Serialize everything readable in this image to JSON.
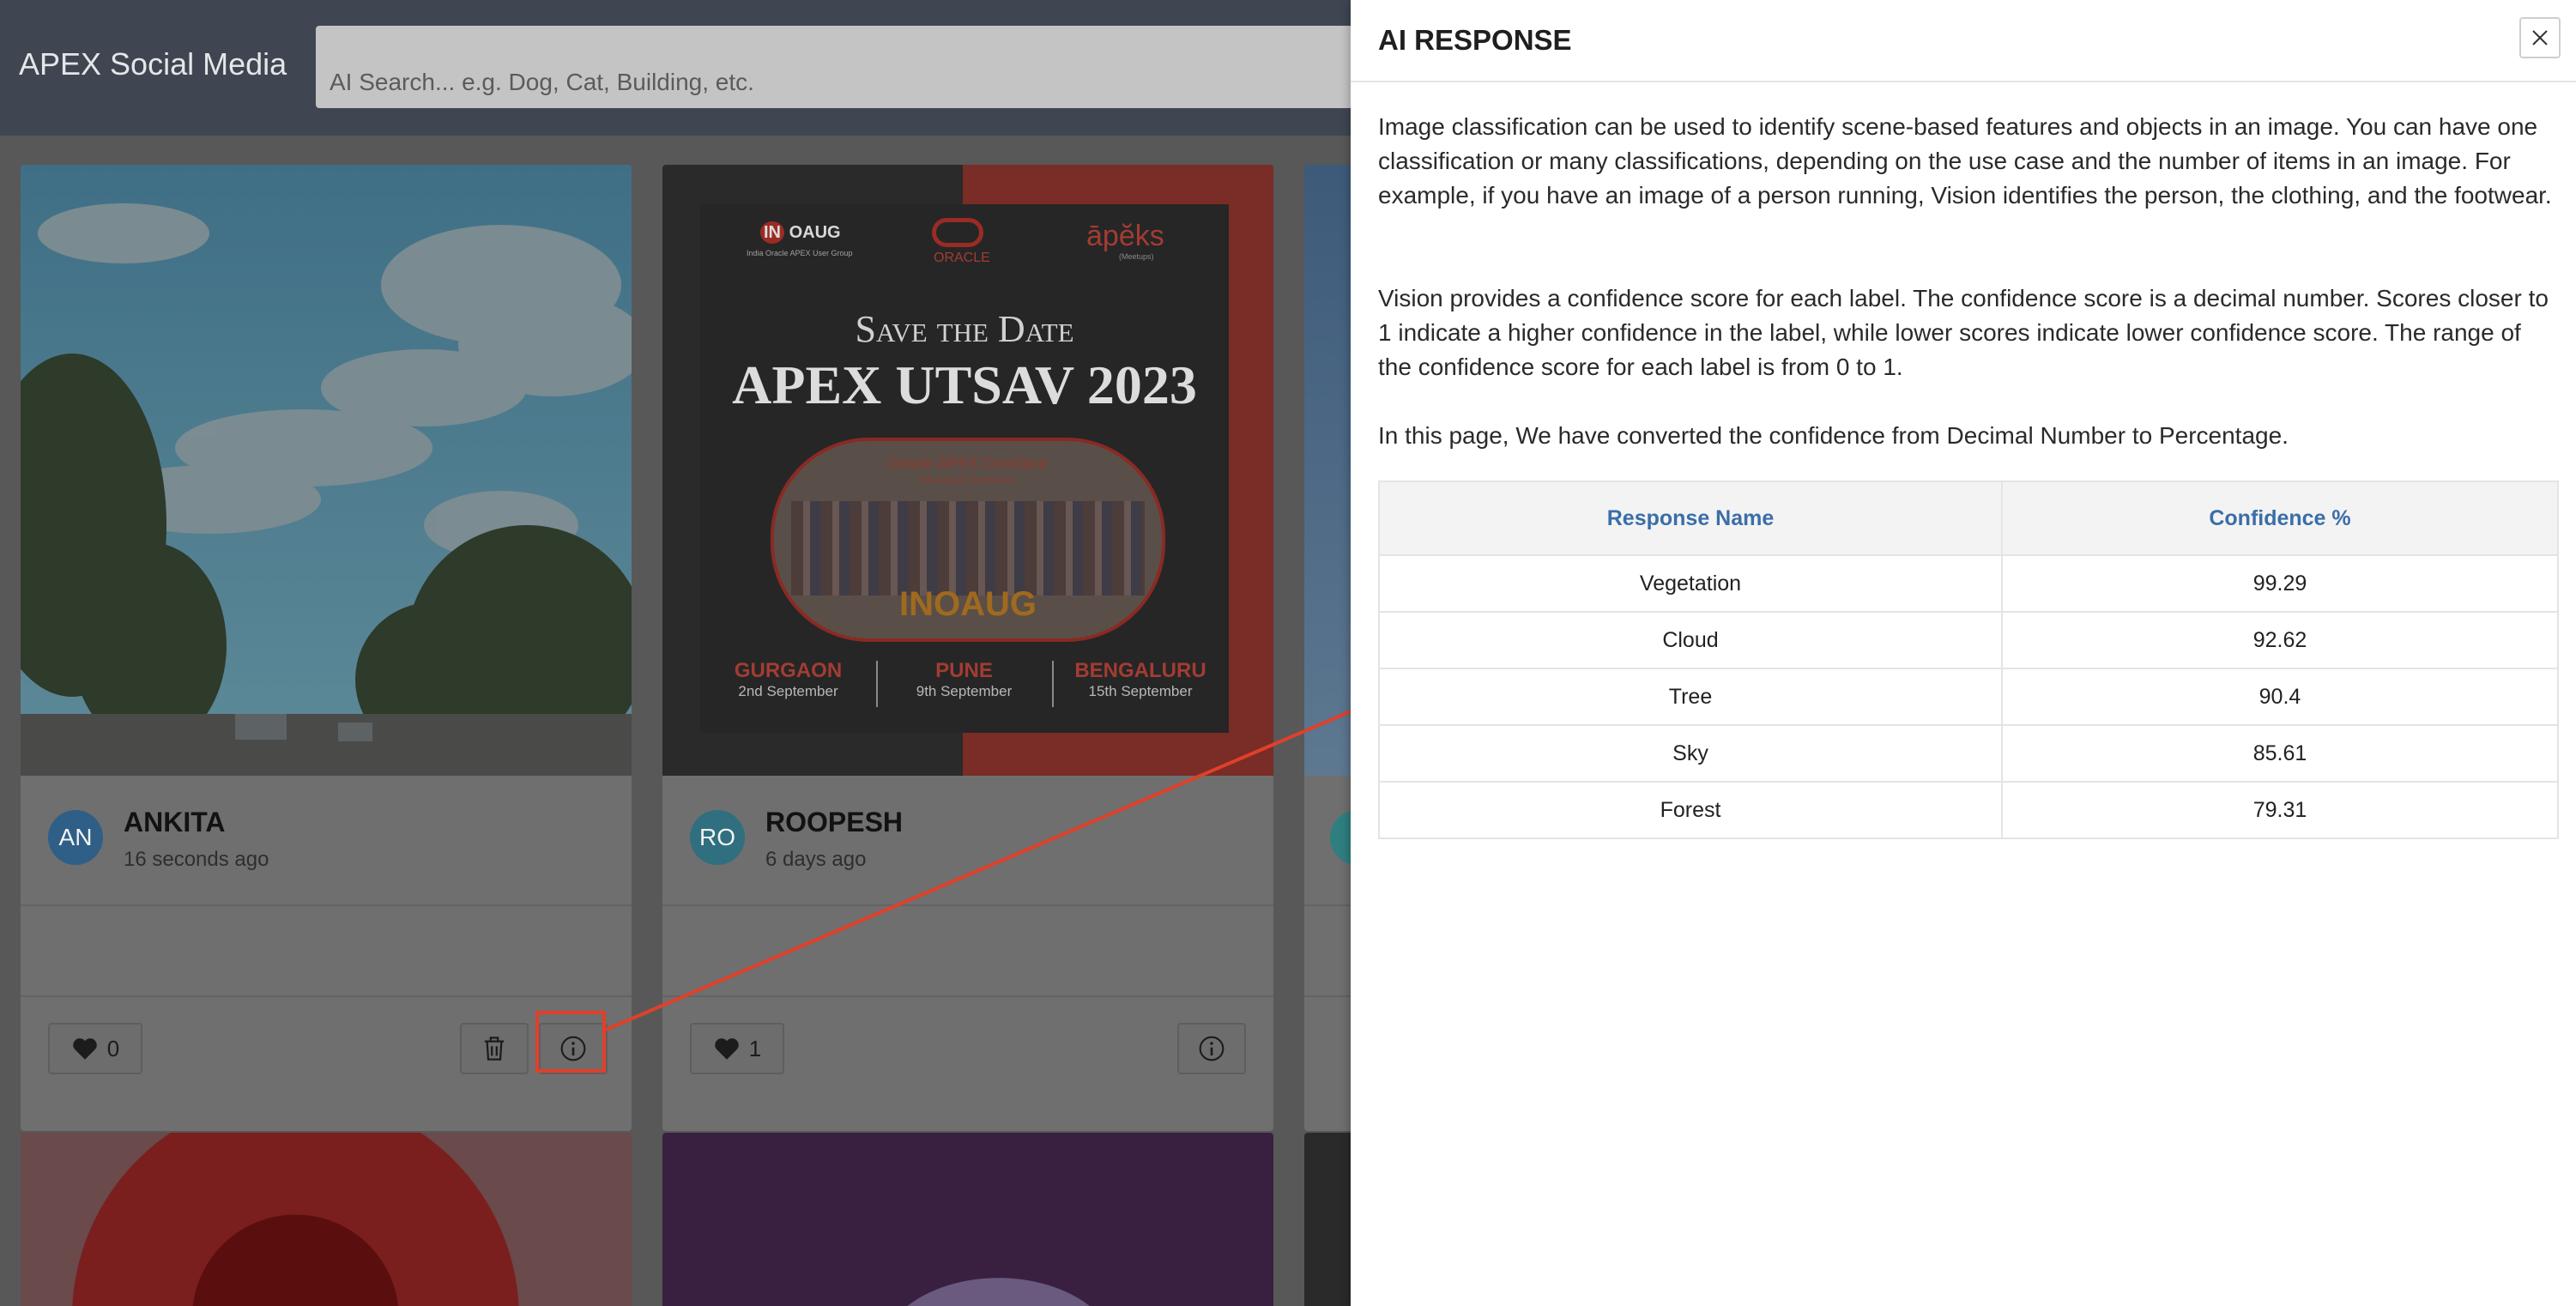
{
  "app": {
    "title": "APEX Social Media"
  },
  "search": {
    "placeholder": "AI Search... e.g. Dog, Cat, Building, etc."
  },
  "posts": [
    {
      "initials": "AN",
      "name": "ANKITA",
      "time": "16 seconds ago",
      "likes": "0",
      "avatar_color": "#3a7cb0"
    },
    {
      "initials": "RO",
      "name": "ROOPESH",
      "time": "6 days ago",
      "likes": "1",
      "avatar_color": "#3a8fa6"
    }
  ],
  "event_poster": {
    "org1": "OAUG",
    "org1_mark": "IN",
    "org1_sub": "India Oracle APEX User Group",
    "org2": "ORACLE",
    "org3": "āpĕks",
    "org3_sub": "(Meetups)",
    "headline1": "Save the Date",
    "headline2": "APEX UTSAV 2023",
    "photo_title": "Oracle APEX Conclave",
    "photo_subtitle": "5th Annual Conference",
    "photo_caption": "INOAUG",
    "city1": "GURGAON",
    "date1": "2nd September",
    "city2": "PUNE",
    "date2": "9th September",
    "city3": "BENGALURU",
    "date3": "15th September"
  },
  "panel": {
    "title": "AI RESPONSE",
    "para1": "Image classification can be used to identify scene-based features and objects in an image. You can have one classification or many classifications, depending on the use case and the number of items in an image. For example, if you have an image of a person running, Vision identifies the person, the clothing, and the footwear.",
    "para2": "Vision provides a confidence score for each label. The confidence score is a decimal number. Scores closer to 1 indicate a higher confidence in the label, while lower scores indicate lower confidence score. The range of the confidence score for each label is from 0 to 1.",
    "para3": "In this page, We have converted the confidence from Decimal Number to Percentage.",
    "table": {
      "headers": [
        "Response Name",
        "Confidence %"
      ],
      "rows": [
        [
          "Vegetation",
          "99.29"
        ],
        [
          "Cloud",
          "92.62"
        ],
        [
          "Tree",
          "90.4"
        ],
        [
          "Sky",
          "85.61"
        ],
        [
          "Forest",
          "79.31"
        ]
      ]
    }
  },
  "colors": {
    "highlight": "#e0402a",
    "header_text": "#3a6ea8",
    "topbar": "#3f4652"
  }
}
